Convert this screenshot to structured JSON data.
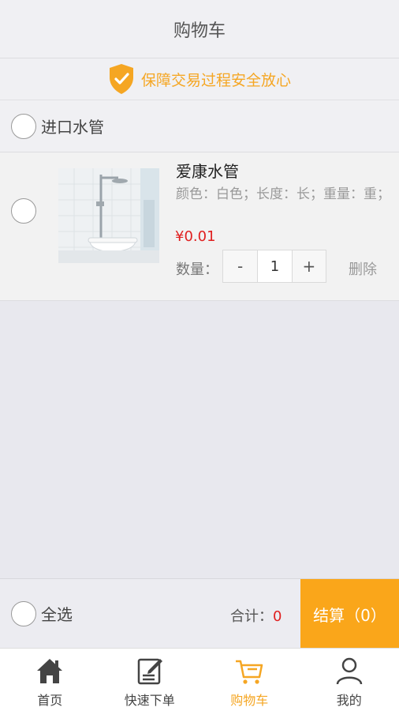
{
  "header": {
    "title": "购物车"
  },
  "banner": {
    "text": "保障交易过程安全放心",
    "icon": "shield-check-icon",
    "color": "#f5a623"
  },
  "shop": {
    "name": "进口水管"
  },
  "cart_item": {
    "title": "爱康水管",
    "spec": "颜色：白色；长度：长；重量：重；",
    "price": "¥0.01",
    "qty_label": "数量：",
    "minus": "-",
    "quantity": "1",
    "plus": "+",
    "delete": "删除"
  },
  "footer": {
    "select_all": "全选",
    "total_label": "合计：",
    "total_value": "0",
    "checkout": "结算（0）"
  },
  "tabs": [
    {
      "label": "首页",
      "icon": "home-icon"
    },
    {
      "label": "快速下单",
      "icon": "quick-order-icon"
    },
    {
      "label": "购物车",
      "icon": "cart-icon",
      "active": true
    },
    {
      "label": "我的",
      "icon": "user-icon"
    }
  ],
  "colors": {
    "accent": "#faa61a",
    "price": "#e02020"
  }
}
